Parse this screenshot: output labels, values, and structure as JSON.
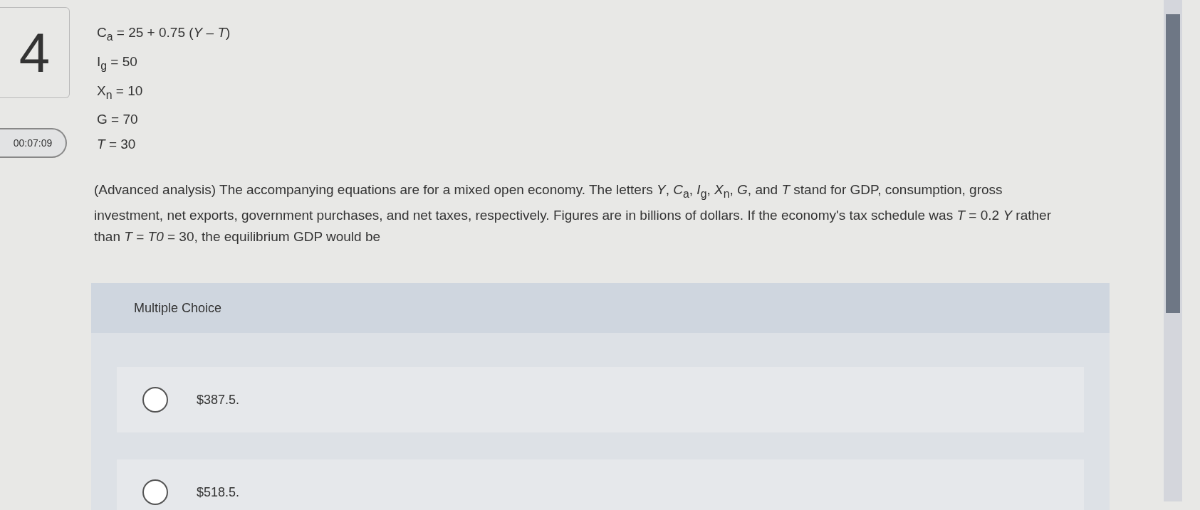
{
  "question_number": "4",
  "timer": "00:07:09",
  "equations": [
    "C$_{a}$ = 25 + 0.75 (*Y* – *T*)",
    "I$_{g}$ = 50",
    "X$_{n}$ = 10",
    "G = 70",
    "*T* = 30"
  ],
  "prompt": "(Advanced analysis) The accompanying equations are for a mixed open economy. The letters *Y*, *C*$_{a}$, *I*$_{g}$, *X*$_{n}$, *G*, and *T* stand for GDP, consumption, gross investment, net exports, government purchases, and net taxes, respectively. Figures are in billions of dollars. If the economy's tax schedule was *T* = 0.2 *Y* rather than *T* = *T0* = 30, the equilibrium GDP would be",
  "choice_panel": {
    "heading": "Multiple Choice",
    "choices": [
      {
        "label": "$387.5.",
        "selected": false
      },
      {
        "label": "$518.5.",
        "selected": false
      }
    ]
  }
}
